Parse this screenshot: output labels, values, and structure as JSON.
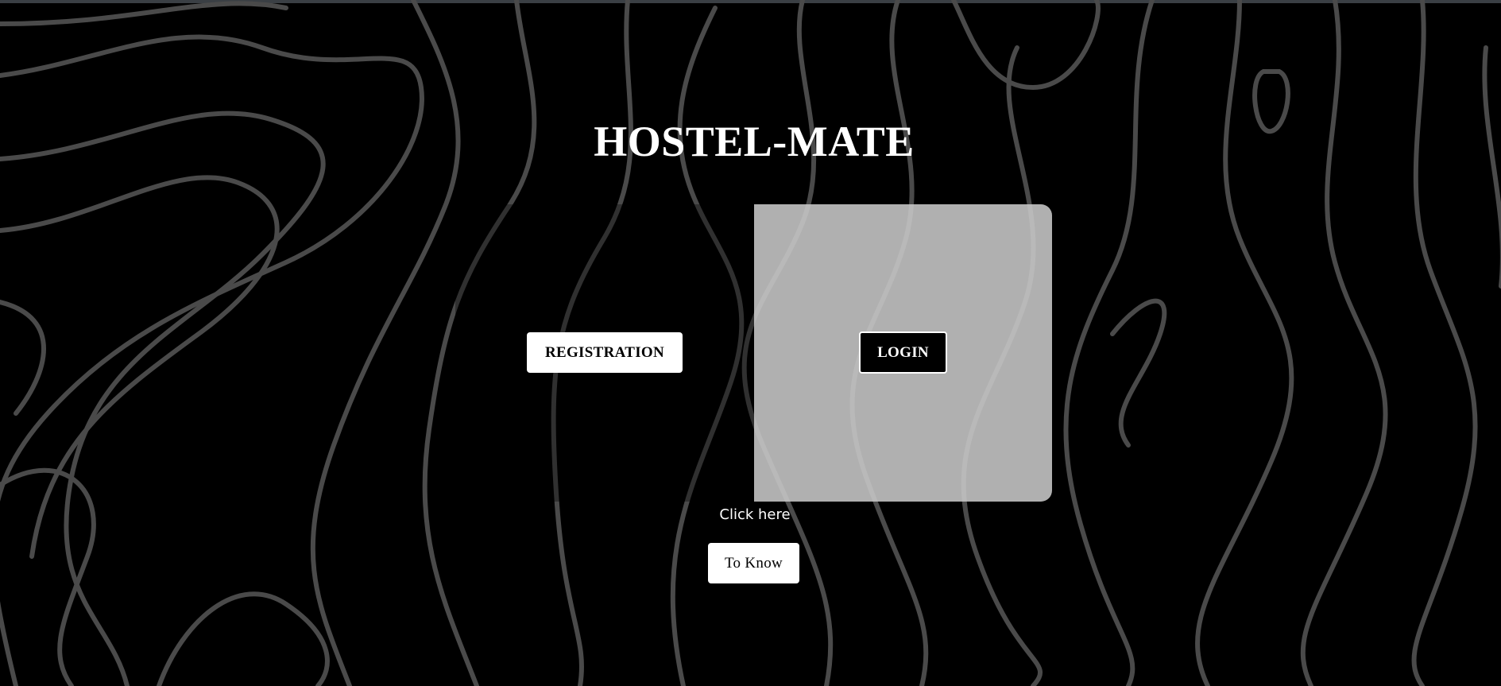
{
  "page": {
    "title": "HOSTEL-MATE"
  },
  "buttons": {
    "registration": "REGISTRATION",
    "login": "LOGIN",
    "to_know": "To Know"
  },
  "helper_text": "Click here",
  "colors": {
    "background": "#000000",
    "pattern_lines": "#4a4a4a",
    "right_panel": "#c8c8c8",
    "text": "#ffffff"
  }
}
